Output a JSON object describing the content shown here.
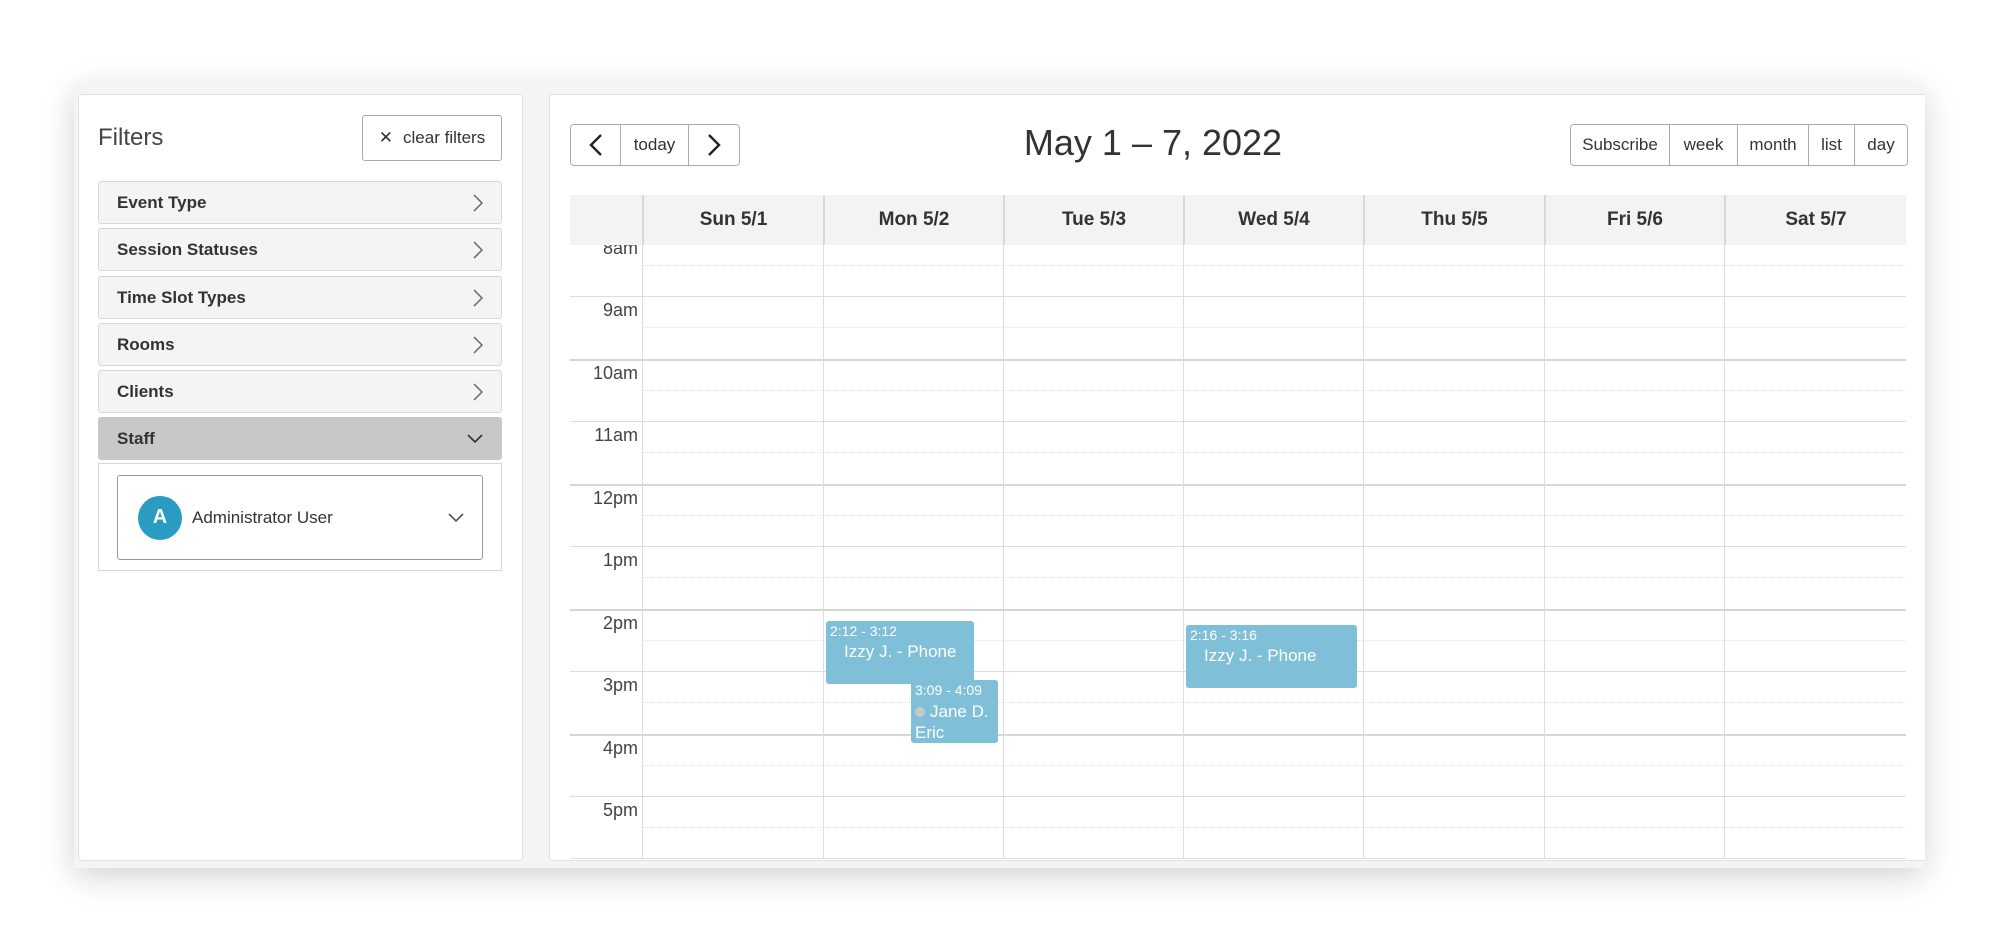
{
  "filters": {
    "title": "Filters",
    "clear_label": "clear filters",
    "items": [
      {
        "label": "Event Type",
        "expanded": false
      },
      {
        "label": "Session Statuses",
        "expanded": false
      },
      {
        "label": "Time Slot Types",
        "expanded": false
      },
      {
        "label": "Rooms",
        "expanded": false
      },
      {
        "label": "Clients",
        "expanded": false
      },
      {
        "label": "Staff",
        "expanded": true
      }
    ],
    "staff_select": {
      "avatar_initial": "A",
      "value": "Administrator User"
    }
  },
  "toolbar": {
    "today_label": "today",
    "title": "May 1 – 7, 2022",
    "views": [
      "Subscribe",
      "week",
      "month",
      "list",
      "day"
    ]
  },
  "calendar": {
    "days": [
      "Sun 5/1",
      "Mon 5/2",
      "Tue 5/3",
      "Wed 5/4",
      "Thu 5/5",
      "Fri 5/6",
      "Sat 5/7"
    ],
    "hours": [
      "8am",
      "9am",
      "10am",
      "11am",
      "12pm",
      "1pm",
      "2pm",
      "3pm",
      "4pm",
      "5pm"
    ],
    "events": [
      {
        "day": "Mon 5/2",
        "time": "2:12 - 3:12",
        "title": "Izzy J. - Phone"
      },
      {
        "day": "Mon 5/2",
        "time": "3:09 - 4:09",
        "title": "Jane D. Eric"
      },
      {
        "day": "Wed 5/4",
        "time": "2:16 - 3:16",
        "title": "Izzy J. - Phone"
      }
    ],
    "event_color": "#7fc0d8"
  }
}
